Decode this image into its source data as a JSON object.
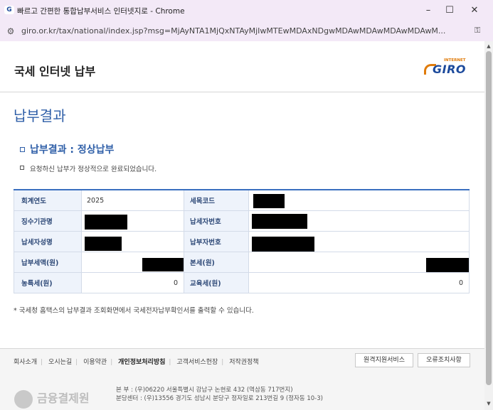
{
  "window": {
    "title": "빠르고 간편한 통합납부서비스 인터넷지로 - Chrome",
    "url": "giro.or.kr/tax/national/index.jsp?msg=MjAyNTA1MjQxNTAyMjIwMTEwMDAxNDgwMDAwMDAwMDAwMDAwM...",
    "minimize_glyph": "–",
    "maximize_glyph": "☐",
    "close_glyph": "✕"
  },
  "header": {
    "title": "국세 인터넷 납부",
    "logo_small": "INTERNET",
    "logo_main": "GIRO"
  },
  "page": {
    "heading": "납부결과",
    "result_title": "납부결과 : 정상납부",
    "notice": "요청하신 납부가 정상적으로 완료되었습니다.",
    "footnote": "* 국세청 홈택스의 납부결과 조회화면에서 국세전자납부확인서를 출력할 수 있습니다."
  },
  "table": {
    "rows": [
      {
        "label1": "회계연도",
        "value1": "2025",
        "label2": "세목코드",
        "value2": ""
      },
      {
        "label1": "징수기관명",
        "value1": "",
        "label2": "납세자번호",
        "value2": ""
      },
      {
        "label1": "납세자성명",
        "value1": "",
        "label2": "납부자번호",
        "value2": ""
      },
      {
        "label1": "납부세액(원)",
        "value1": "",
        "label2": "본세(원)",
        "value2": ""
      },
      {
        "label1": "농특세(원)",
        "value1": "0",
        "label2": "교육세(원)",
        "value2": "0"
      }
    ]
  },
  "footer": {
    "links": [
      "회사소개",
      "오시는길",
      "이용약관",
      "개인정보처리방침",
      "고객서비스헌장",
      "저작권정책"
    ],
    "btn_remote": "원격지원서비스",
    "btn_error": "오류조치사항",
    "org_name": "금융결제원",
    "address_main": "본 부 : (우)06220 서울특별시 강남구 논현로 432 (역삼동 717번지)",
    "address_branch": "분당센터 : (우)13556 경기도 성남시 분당구 정자일로 213번길 9 (정자동 10-3)"
  }
}
